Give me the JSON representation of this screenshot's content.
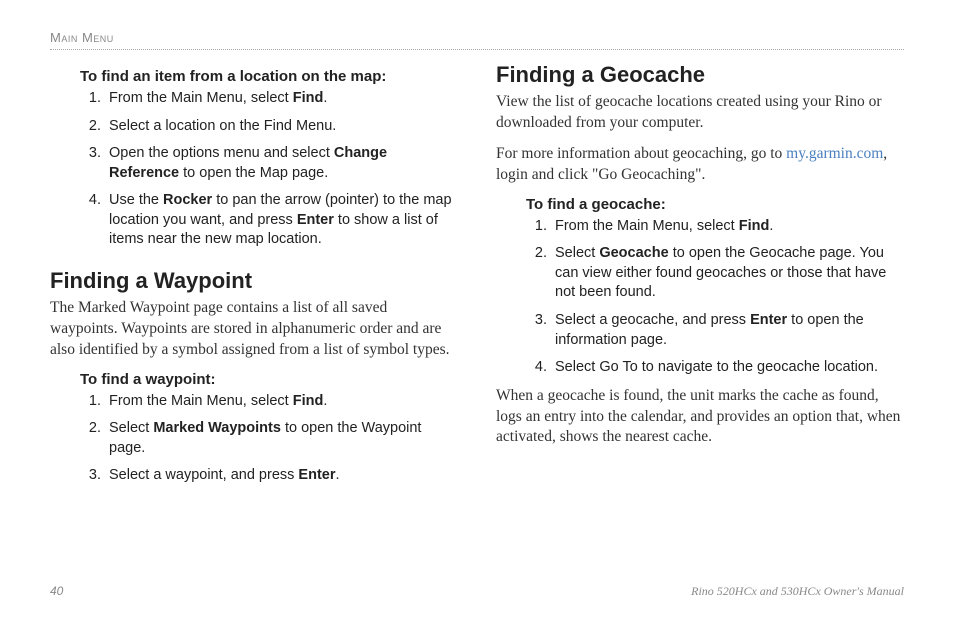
{
  "header": {
    "section": "Main Menu"
  },
  "left": {
    "sub1_title": "To find an item from a location on the map:",
    "sub1_items": [
      {
        "pre": "From the Main Menu, select ",
        "b1": "Find",
        "post": "."
      },
      {
        "pre": "Select a location on the Find Menu."
      },
      {
        "pre": "Open the options menu and select ",
        "b1": "Change Reference",
        "post": " to open the Map page."
      },
      {
        "pre": "Use the ",
        "b1": "Rocker",
        "mid": " to pan the arrow (pointer) to the map location you want, and press ",
        "b2": "Enter",
        "post": " to show a list of items near the new map location."
      }
    ],
    "section_title": "Finding a Waypoint",
    "section_body": "The Marked Waypoint page contains a list of all saved waypoints. Waypoints are stored in alphanumeric order and are also identified by a symbol assigned from a list of symbol types.",
    "sub2_title": "To find a waypoint:",
    "sub2_items": [
      {
        "pre": "From the Main Menu, select ",
        "b1": "Find",
        "post": "."
      },
      {
        "pre": "Select ",
        "b1": "Marked Waypoints",
        "post": " to open the Waypoint page."
      },
      {
        "pre": "Select a waypoint, and press ",
        "b1": "Enter",
        "post": "."
      }
    ]
  },
  "right": {
    "section_title": "Finding a Geocache",
    "section_body": "View the list of geocache locations created using your Rino or downloaded from your computer.",
    "info_pre": "For more information about geocaching, go to ",
    "info_link": "my.garmin.com",
    "info_post": ", login and click \"Go Geocaching\".",
    "sub1_title": "To find a geocache:",
    "sub1_items": [
      {
        "pre": "From the Main Menu, select ",
        "b1": "Find",
        "post": "."
      },
      {
        "pre": "Select ",
        "b1": "Geocache",
        "post": " to open the Geocache page. You can view either found geocaches or those that have not been found."
      },
      {
        "pre": "Select a geocache, and press ",
        "b1": "Enter",
        "post": " to open the information page."
      },
      {
        "pre": "Select Go To to navigate to the geocache location."
      }
    ],
    "closing": "When a geocache is found, the unit marks the cache as found, logs an entry into the calendar, and provides an option that, when activated, shows the nearest cache."
  },
  "footer": {
    "page": "40",
    "manual": "Rino 520HCx and 530HCx Owner's Manual"
  }
}
